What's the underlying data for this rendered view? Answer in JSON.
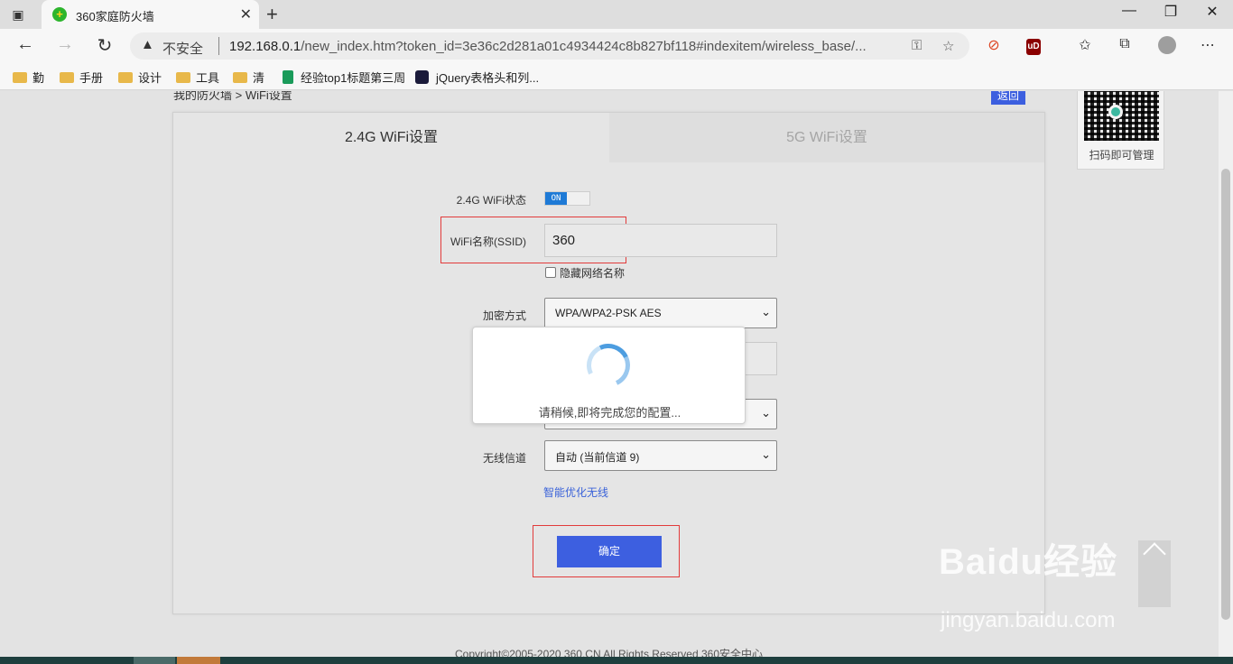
{
  "browser": {
    "tab_title": "360家庭防火墙",
    "tab_close": "✕",
    "new_tab": "+",
    "window_buttons": [
      "—",
      "❐",
      "✕"
    ],
    "security_label": "不安全",
    "url_host": "192.168.0.1",
    "url_path": "/new_index.htm?token_id=3e36c2d281a01c4934424c8b827bf118#indexitem/wireless_base/...",
    "bookmarks": [
      "勤",
      "手册",
      "设计",
      "工具",
      "清",
      "经验top1标题第三周",
      "jQuery表格头和列..."
    ]
  },
  "page": {
    "breadcrumb": "我的防火墙 > WiFi设置",
    "back_label": "返回",
    "qr_label": "扫码即可管理",
    "tabs": [
      "2.4G WiFi设置",
      "5G WiFi设置"
    ],
    "form": {
      "status_label": "2.4G WiFi状态",
      "status_value": "ON",
      "ssid_label": "WiFi名称(SSID)",
      "ssid_value": "360",
      "hide_ssid_label": "隐藏网络名称",
      "encryption_label": "加密方式",
      "encryption_value": "WPA/WPA2-PSK AES",
      "channel_label": "无线信道",
      "channel_value": "自动 (当前信道 9)",
      "optimize_link": "智能优化无线",
      "confirm_label": "确定"
    },
    "modal_text": "请稍候,即将完成您的配置...",
    "footer": "Copyright©2005-2020 360.CN All Rights Reserved 360安全中心"
  },
  "watermark": {
    "brand": "Baidu经验",
    "url": "jingyan.baidu.com"
  }
}
